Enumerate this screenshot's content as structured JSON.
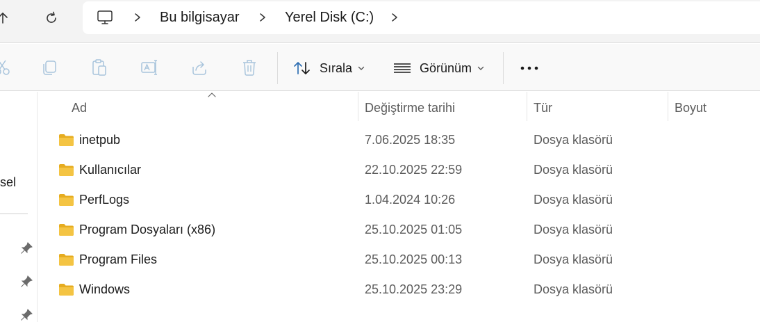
{
  "breadcrumb": {
    "items": [
      "Bu bilgisayar",
      "Yerel Disk (C:)"
    ]
  },
  "toolbar": {
    "sort_label": "Sırala",
    "view_label": "Görünüm",
    "more_label": "•••",
    "icons": [
      "cut-icon",
      "copy-icon",
      "paste-icon",
      "rename-icon",
      "share-icon",
      "delete-icon"
    ]
  },
  "leftpane": {
    "partial_label": "sel"
  },
  "columns": {
    "name": "Ad",
    "modified": "Değiştirme tarihi",
    "type": "Tür",
    "size": "Boyut"
  },
  "files": [
    {
      "name": "inetpub",
      "modified": "7.06.2025 18:35",
      "type": "Dosya klasörü"
    },
    {
      "name": "Kullanıcılar",
      "modified": "22.10.2025 22:59",
      "type": "Dosya klasörü"
    },
    {
      "name": "PerfLogs",
      "modified": "1.04.2024 10:26",
      "type": "Dosya klasörü"
    },
    {
      "name": "Program Dosyaları (x86)",
      "modified": "25.10.2025 01:05",
      "type": "Dosya klasörü"
    },
    {
      "name": "Program Files",
      "modified": "25.10.2025 00:13",
      "type": "Dosya klasörü"
    },
    {
      "name": "Windows",
      "modified": "25.10.2025 23:29",
      "type": "Dosya klasörü"
    }
  ],
  "colors": {
    "folder": "#f4c443",
    "folder_dark": "#e6ac1f",
    "icon_disabled": "#a8c4dc",
    "icon_active": "#2f6fb3"
  }
}
